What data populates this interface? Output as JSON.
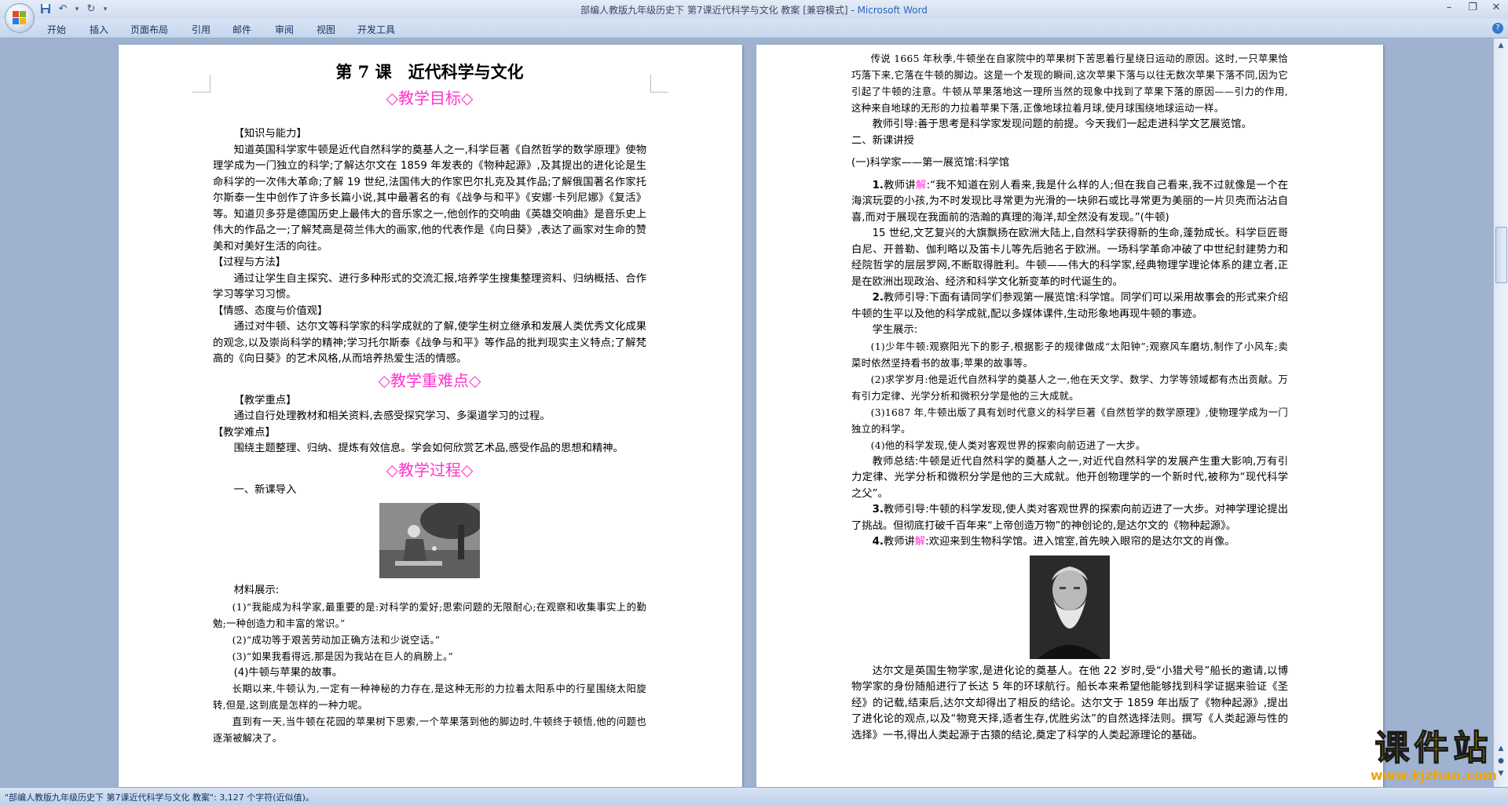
{
  "window": {
    "title_doc": "部编人教版九年级历史下 第7课近代科学与文化  教案 [兼容模式]",
    "title_sep": " - ",
    "title_app": "Microsoft Word"
  },
  "qat": {
    "save_icon": "save-icon",
    "undo_icon": "undo-icon",
    "redo_icon": "redo-icon"
  },
  "ribbon": {
    "tabs": [
      "开始",
      "插入",
      "页面布局",
      "引用",
      "邮件",
      "审阅",
      "视图",
      "开发工具"
    ]
  },
  "left_page": {
    "lesson_title": "第 7 课　近代科学与文化",
    "goal_heading": "◇教学目标◇",
    "k_label": "【知识与能力】",
    "k_text": "知道英国科学家牛顿是近代自然科学的奠基人之一,科学巨著《自然哲学的数学原理》使物理学成为一门独立的科学;了解达尔文在 1859 年发表的《物种起源》,及其提出的进化论是生命科学的一次伟大革命;了解 19 世纪,法国伟大的作家巴尔扎克及其作品;了解俄国著名作家托尔斯泰一生中创作了许多长篇小说,其中最著名的有《战争与和平》《安娜·卡列尼娜》《复活》等。知道贝多芬是德国历史上最伟大的音乐家之一,他创作的交响曲《英雄交响曲》是音乐史上伟大的作品之一;了解梵高是荷兰伟大的画家,他的代表作是《向日葵》,表达了画家对生命的赞美和对美好生活的向往。",
    "p_label": "【过程与方法】",
    "p_text": "通过让学生自主探究、进行多种形式的交流汇报,培养学生搜集整理资料、归纳概括、合作学习等学习习惯。",
    "e_label": "【情感、态度与价值观】",
    "e_text": "通过对牛顿、达尔文等科学家的科学成就的了解,使学生树立继承和发展人类优秀文化成果的观念,以及崇尚科学的精神;学习托尔斯泰《战争与和平》等作品的批判现实主义特点;了解梵高的《向日葵》的艺术风格,从而培养热爱生活的情感。",
    "key_heading": "◇教学重难点◇",
    "key_label": "【教学重点】",
    "key_text": "通过自行处理教材和相关资料,去感受探究学习、多渠道学习的过程。",
    "diff_label": "【教学难点】",
    "diff_text": "围绕主题整理、归纳、提炼有效信息。学会如何欣赏艺术品,感受作品的思想和精神。",
    "proc_heading": "◇教学过程◇",
    "intro_heading": "一、新课导入",
    "material_label": "材料展示:",
    "q1": "(1)“我能成为科学家,最重要的是:对科学的爱好;思索问题的无限耐心;在观察和收集事实上的勤勉;一种创造力和丰富的常识。”",
    "q2": "(2)“成功等于艰苦劳动加正确方法和少说空话。”",
    "q3": "(3)“如果我看得远,那是因为我站在巨人的肩膀上。”",
    "q4": "(4)牛顿与苹果的故事。",
    "story1": "长期以来,牛顿认为,一定有一种神秘的力存在,是这种无形的力拉着太阳系中的行星围绕太阳旋转,但是,这到底是怎样的一种力呢。",
    "story2": "直到有一天,当牛顿在花园的苹果树下思索,一个苹果落到他的脚边时,牛顿终于顿悟,他的问题也逐渐被解决了。"
  },
  "right_page": {
    "legend": "传说 1665 年秋季,牛顿坐在自家院中的苹果树下苦思着行星绕日运动的原因。这时,一只苹果恰巧落下来,它落在牛顿的脚边。这是一个发现的瞬间,这次苹果下落与以往无数次苹果下落不同,因为它引起了牛顿的注意。牛顿从苹果落地这一理所当然的现象中找到了苹果下落的原因——引力的作用,这种来自地球的无形的力拉着苹果下落,正像地球拉着月球,使月球围绕地球运动一样。",
    "guide1": "教师引导:善于思考是科学家发现问题的前提。今天我们一起走进科学文艺展览馆。",
    "new_lesson": "二、新课讲授",
    "section1": "(一)科学家——第一展览馆:科学馆",
    "t1_num": "1.",
    "t1_pre": "教师讲",
    "t1_jie": "解",
    "t1_quote": ":“我不知道在别人看来,我是什么样的人;但在我自己看来,我不过就像是一个在海滨玩耍的小孩,为不时发现比寻常更为光滑的一块卵石或比寻常更为美丽的一片贝壳而沾沾自喜,而对于展现在我面前的浩瀚的真理的海洋,却全然没有发现。”(牛顿)",
    "renaissance": "15 世纪,文艺复兴的大旗飘扬在欧洲大陆上,自然科学获得新的生命,蓬勃成长。科学巨匠哥白尼、开普勒、伽利略以及笛卡儿等先后驰名于欧洲。一场科学革命冲破了中世纪封建势力和经院哲学的层层罗网,不断取得胜利。牛顿——伟大的科学家,经典物理学理论体系的建立者,正是在欧洲出现政治、经济和科学文化新变革的时代诞生的。",
    "t2_num": "2.",
    "t2": "教师引导:下面有请同学们参观第一展览馆:科学馆。同学们可以采用故事会的形式来介绍牛顿的生平以及他的科学成就,配以多媒体课件,生动形象地再现牛顿的事迹。",
    "show_label": "学生展示:",
    "s1": "(1)少年牛顿:观察阳光下的影子,根据影子的规律做成“太阳钟”;观察风车磨坊,制作了小风车;卖菜时依然坚持看书的故事;苹果的故事等。",
    "s2": "(2)求学岁月:他是近代自然科学的奠基人之一,他在天文学、数学、力学等领域都有杰出贡献。万有引力定律、光学分析和微积分学是他的三大成就。",
    "s3": "(3)1687 年,牛顿出版了具有划时代意义的科学巨著《自然哲学的数学原理》,使物理学成为一门独立的科学。",
    "s4": "(4)他的科学发现,使人类对客观世界的探索向前迈进了一大步。",
    "summary": "教师总结:牛顿是近代自然科学的奠基人之一,对近代自然科学的发展产生重大影响,万有引力定律、光学分析和微积分学是他的三大成就。他开创物理学的一个新时代,被称为“现代科学之父”。",
    "t3_num": "3.",
    "t3": "教师引导:牛顿的科学发现,使人类对客观世界的探索向前迈进了一大步。对神学理论提出了挑战。但彻底打破千百年来“上帝创造万物”的神创论的,是达尔文的《物种起源》。",
    "t4_num": "4.",
    "t4_pre": "教师讲",
    "t4_jie": "解",
    "t4_post": ":欢迎来到生物科学馆。进入馆室,首先映入眼帘的是达尔文的肖像。",
    "darwin": "达尔文是英国生物学家,是进化论的奠基人。在他 22 岁时,受“小猎犬号”船长的邀请,以博物学家的身份随船进行了长达 5 年的环球航行。船长本来希望他能够找到科学证据来验证《圣经》的记载,结束后,达尔文却得出了相反的结论。达尔文于 1859 年出版了《物种起源》,提出了进化论的观点,以及“物竞天择,适者生存,优胜劣汰”的自然选择法则。撰写《人类起源与性的选择》一书,得出人类起源于古猿的结论,奠定了科学的人类起源理论的基础。"
  },
  "status_bar": {
    "text": "\"部编人教版九年级历史下 第7课近代科学与文化  教案\": 3,127 个字符(近似值)。"
  },
  "watermark": {
    "text": "课件站",
    "url": "www.kjzhan.com"
  },
  "colors": {
    "accent_pink": "#ff33cc",
    "title_blue": "#2e63b8"
  }
}
